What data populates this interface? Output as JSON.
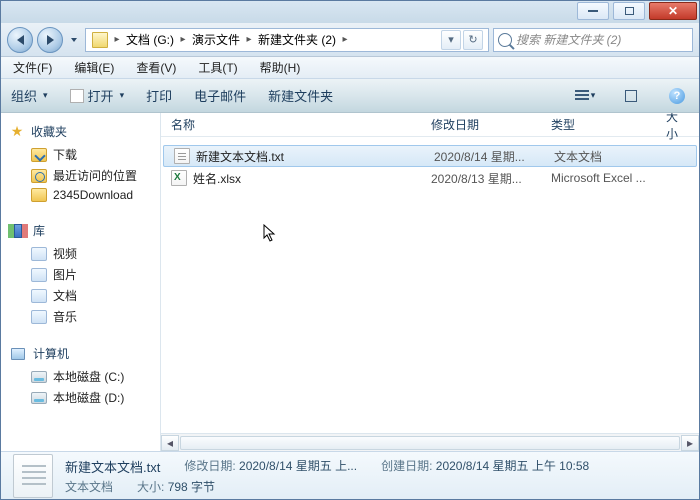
{
  "titlebar": {},
  "nav": {
    "path": [
      "文档 (G:)",
      "演示文件",
      "新建文件夹 (2)"
    ],
    "search_placeholder": "搜索 新建文件夹 (2)"
  },
  "menubar": [
    "文件(F)",
    "编辑(E)",
    "查看(V)",
    "工具(T)",
    "帮助(H)"
  ],
  "cmdbar": {
    "organize": "组织",
    "open": "打开",
    "print": "打印",
    "email": "电子邮件",
    "new_folder": "新建文件夹"
  },
  "sidebar": {
    "favorites": {
      "label": "收藏夹",
      "items": [
        "下载",
        "最近访问的位置",
        "2345Download"
      ]
    },
    "libraries": {
      "label": "库",
      "items": [
        "视频",
        "图片",
        "文档",
        "音乐"
      ]
    },
    "computer": {
      "label": "计算机",
      "items": [
        "本地磁盘 (C:)",
        "本地磁盘 (D:)"
      ]
    }
  },
  "columns": {
    "name": "名称",
    "date": "修改日期",
    "type": "类型",
    "size": "大小"
  },
  "files": [
    {
      "name": "新建文本文档.txt",
      "date": "2020/8/14 星期...",
      "type": "文本文档",
      "icon": "txt",
      "selected": true
    },
    {
      "name": "姓名.xlsx",
      "date": "2020/8/13 星期...",
      "type": "Microsoft Excel ...",
      "icon": "xlsx",
      "selected": false
    }
  ],
  "details": {
    "name": "新建文本文档.txt",
    "type": "文本文档",
    "mod_label": "修改日期:",
    "mod_value": "2020/8/14 星期五 上...",
    "created_label": "创建日期:",
    "created_value": "2020/8/14 星期五 上午 10:58",
    "size_label": "大小:",
    "size_value": "798 字节"
  }
}
